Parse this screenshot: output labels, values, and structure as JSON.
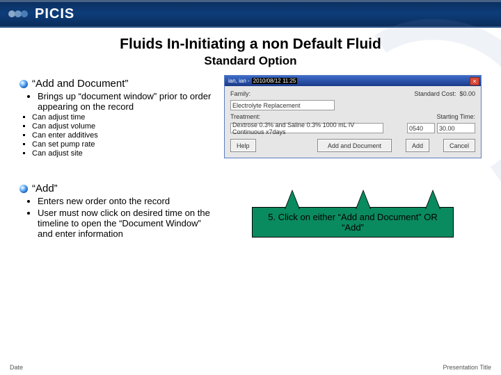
{
  "header": {
    "brand": "PICIS"
  },
  "title_line1": "Fluids In-Initiating a non Default Fluid",
  "title_line2": "Standard Option",
  "section1": {
    "heading": "“Add and Document”",
    "bullet1": "Brings up “document window” prior to order appearing on the record",
    "subs": [
      "Can adjust time",
      "Can adjust volume",
      "Can enter additives",
      "Can set pump rate",
      "Can adjust site"
    ]
  },
  "section2": {
    "heading": "“Add”",
    "bullets": [
      "Enters new order onto the record",
      "User must now click on desired time on the timeline to open the “Document Window” and enter information"
    ]
  },
  "dialog": {
    "title_prefix": "ian, ian -",
    "title_time": "2010/08/12 11:25",
    "family_label": "Family:",
    "family_value": "Electrolyte Replacement",
    "stdcost_label": "Standard Cost:",
    "stdcost_value": "$0.00",
    "treatment_label": "Treatment:",
    "treatment_value": "Dextrose 0.3% and Saline 0.3% 1000 mL IV Continuous x7days",
    "starting_label": "Starting Time:",
    "starting_time": "0540",
    "starting_spin": "30.00",
    "buttons": {
      "help": "Help",
      "add_doc": "Add and Document",
      "add": "Add",
      "cancel": "Cancel"
    }
  },
  "callout": {
    "text": "5. Click on either “Add and Document” OR “Add”"
  },
  "footer": {
    "left": "Date",
    "right": "Presentation Title"
  }
}
